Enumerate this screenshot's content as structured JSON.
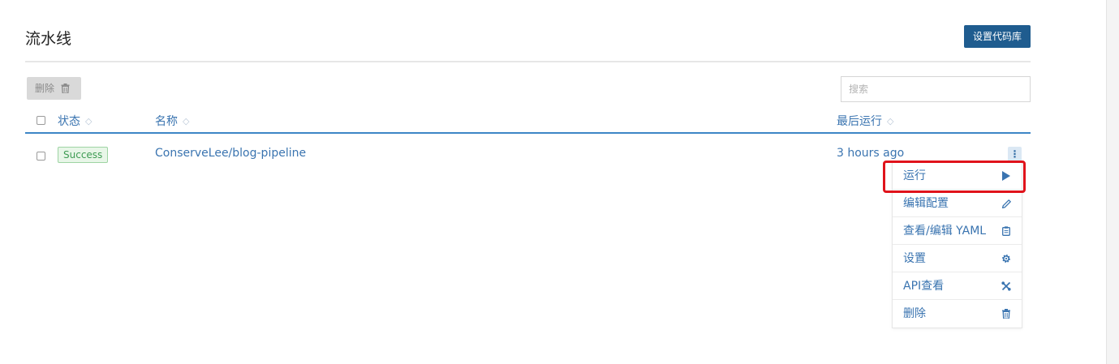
{
  "page": {
    "title": "流水线",
    "setup_repo_label": "设置代码库"
  },
  "toolbar": {
    "delete_label": "删除",
    "search_placeholder": "搜索"
  },
  "table": {
    "columns": [
      "状态",
      "名称",
      "最后运行"
    ],
    "rows": [
      {
        "status": "Success",
        "name": "ConserveLee/blog-pipeline",
        "last_run": "3 hours ago"
      }
    ]
  },
  "menu": {
    "items": [
      {
        "label": "运行",
        "icon": "play-icon"
      },
      {
        "label": "编辑配置",
        "icon": "pencil-icon"
      },
      {
        "label": "查看/编辑 YAML",
        "icon": "clipboard-icon"
      },
      {
        "label": "设置",
        "icon": "gear-icon"
      },
      {
        "label": "API查看",
        "icon": "wrench-icon"
      },
      {
        "label": "删除",
        "icon": "trash-icon"
      }
    ]
  },
  "colors": {
    "accent": "#3a74b0",
    "primary_button": "#1f5c8f",
    "success": "#3e9c53",
    "highlight": "#e0131b"
  }
}
